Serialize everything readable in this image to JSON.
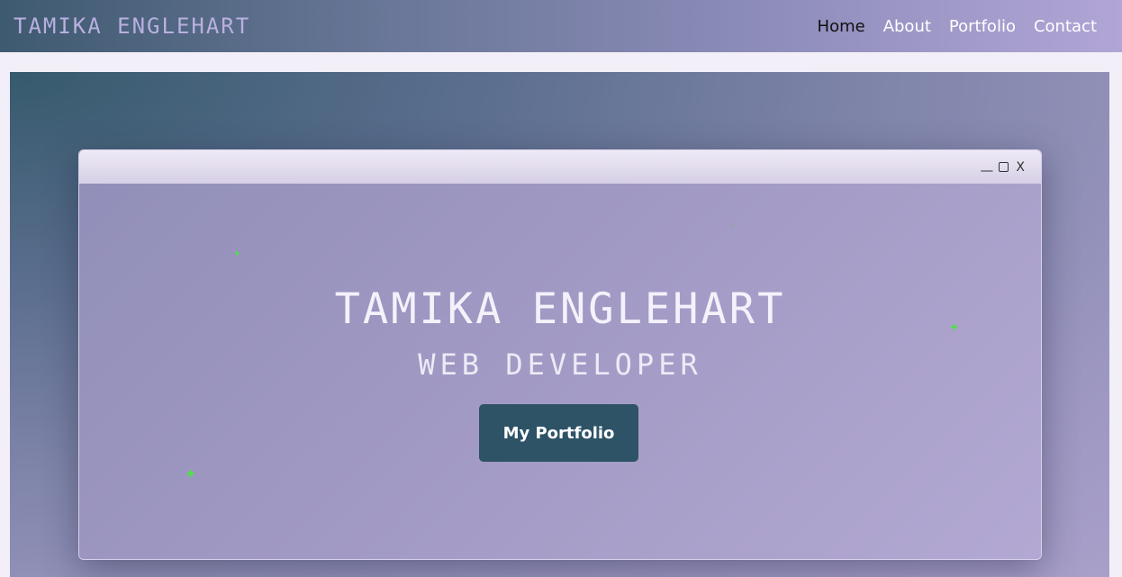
{
  "header": {
    "brand": "TAMIKA ENGLEHART",
    "nav": [
      {
        "label": "Home",
        "active": true
      },
      {
        "label": "About",
        "active": false
      },
      {
        "label": "Portfolio",
        "active": false
      },
      {
        "label": "Contact",
        "active": false
      }
    ]
  },
  "window": {
    "controls": {
      "minimize": "__",
      "close": "X"
    }
  },
  "hero": {
    "name": "TAMIKA ENGLEHART",
    "role": "WEB DEVELOPER",
    "cta_label": "My Portfolio"
  },
  "colors": {
    "button": "#2e5266",
    "sparkle": "#4fe04a",
    "active_nav": "#111111"
  }
}
